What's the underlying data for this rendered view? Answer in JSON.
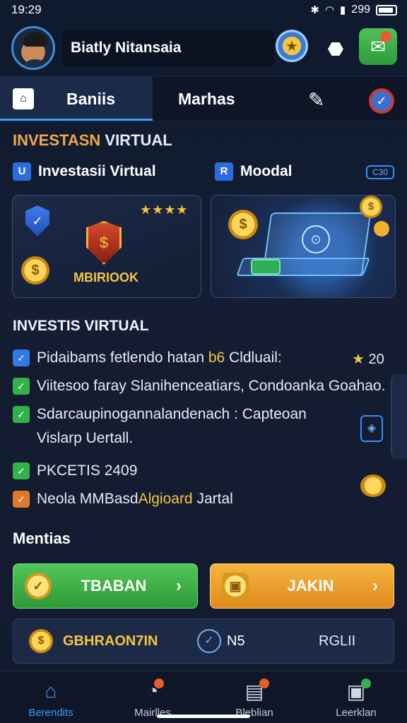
{
  "status": {
    "time": "19:29",
    "battery_text": "299",
    "icons": [
      "bluetooth-icon",
      "wifi-icon",
      "signal-icon",
      "battery-icon"
    ]
  },
  "profile": {
    "name": "Biatly Nitansaia"
  },
  "tabs": [
    {
      "label": "Baniis",
      "active": true
    },
    {
      "label": "Marhas",
      "active": false
    }
  ],
  "section1": {
    "title_accent": "INVESTASN",
    "title_rest": " VIRTUAL",
    "left_sub": "Investasii Virtual",
    "left_sub_icon": "U",
    "right_sub": "Moodal",
    "right_sub_icon": "R",
    "chip": "C30"
  },
  "card_left": {
    "label": "MBIRIOOK",
    "stars": "★★★★"
  },
  "section2": {
    "title": "INVESTIS VIRTUAL",
    "rating_star": "★",
    "rating_value": "20",
    "features": [
      {
        "pre": "Pidaibams fetlendo hatan ",
        "hl": "b6",
        "post": " Cldluail:",
        "color": "blue"
      },
      {
        "pre": "Viitesoo faray Slanihenceatiars, Condoanka Goahao.",
        "hl": "",
        "post": "",
        "color": "green"
      },
      {
        "pre": "Sdarcaupinogannalandenach : Capteoan Vislarp Uertall.",
        "hl": "",
        "post": "",
        "color": "green"
      },
      {
        "pre": "PKCETIS 2409",
        "hl": "",
        "post": "",
        "color": "green"
      },
      {
        "pre": "Neola MMBasd",
        "hl": "Algioard",
        "post": " Jartal",
        "color": "orange"
      }
    ]
  },
  "section3": {
    "title": "Mentias",
    "btn_primary": "TBABAN",
    "btn_secondary": "JAKIN"
  },
  "stats": {
    "label1": "GBHRAON7IN",
    "label2": "N5",
    "label3": "RGLII"
  },
  "nav": [
    {
      "label": "Berendits",
      "icon": "home-icon",
      "active": true
    },
    {
      "label": "Mairlles",
      "icon": "stopwatch-icon",
      "active": false
    },
    {
      "label": "Bleblian",
      "icon": "game-icon",
      "active": false
    },
    {
      "label": "Leerklan",
      "icon": "trophy-icon",
      "active": false
    }
  ],
  "colors": {
    "accent": "#3a9cff",
    "gold": "#f5c542",
    "green": "#33b24a",
    "orange": "#e0792b",
    "background": "#141d33"
  }
}
